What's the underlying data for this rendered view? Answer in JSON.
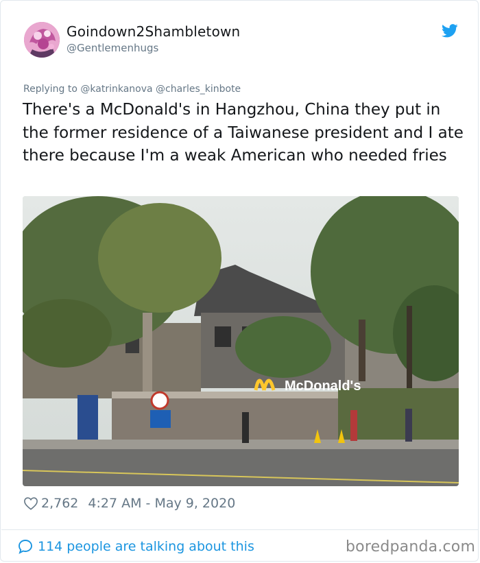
{
  "tweet": {
    "display_name": "Goindown2Shambletown",
    "handle": "@Gentlemenhugs",
    "replying_prefix": "Replying to",
    "reply_mention_1": "@katrinkanova",
    "reply_mention_2": "@charles_kinbote",
    "text": "There's a McDonald's in Hangzhou, China they put in the former residence of a Taiwanese president and I ate there because I'm a weak American who needed fries",
    "photo_sign": "McDonald's",
    "likes": "2,762",
    "timestamp": "4:27 AM - May 9, 2020",
    "talking": "114 people are talking about this"
  },
  "watermark": "boredpanda.com",
  "icons": {
    "avatar": "avatar-image",
    "bird": "twitter-bird-icon",
    "heart": "heart-icon",
    "bubble": "comment-bubble-icon"
  },
  "colors": {
    "twitter_blue": "#1da1f2",
    "link_blue": "#1b95e0",
    "secondary_gray": "#657786",
    "text": "#14171a",
    "mcd_yellow": "#ffc72c"
  }
}
